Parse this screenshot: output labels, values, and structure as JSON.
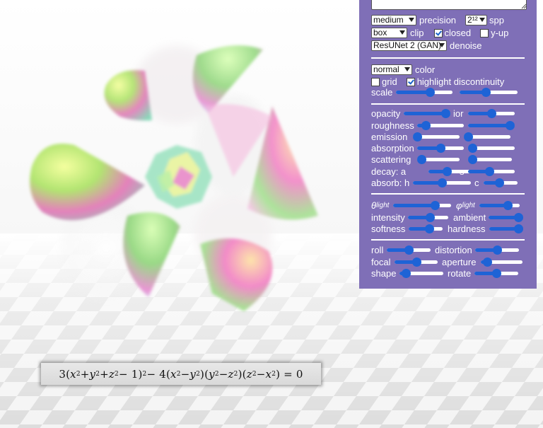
{
  "scene": {
    "formula_tokens": [
      "3(",
      "x",
      "2",
      " + ",
      "y",
      "2",
      " + ",
      "z",
      "2",
      " − 1)",
      "2",
      " − 4(",
      "x",
      "2",
      " − ",
      "y",
      "2",
      ")(",
      "y",
      "2",
      " − ",
      "z",
      "2",
      ")(",
      "z",
      "2",
      " − ",
      "x",
      "2",
      ") = 0"
    ],
    "formula": "3(x² + y² + z² − 1)² − 4(x² − y²)(y² − z²)(z² − x²) = 0"
  },
  "panel": {
    "background": "#7f6fb7",
    "accent": "#1e63d6",
    "render": {
      "precision_value": "medium",
      "precision_label": "precision",
      "spp_value": "2¹²",
      "spp_label": "spp",
      "clip_value": "box",
      "clip_label": "clip",
      "closed_label": "closed",
      "closed_checked": true,
      "yup_label": "y-up",
      "yup_checked": false,
      "denoise_value": "ResUNet 2 (GAN)",
      "denoise_label": "denoise"
    },
    "color": {
      "color_value": "normal",
      "color_label": "color",
      "grid_label": "grid",
      "grid_checked": false,
      "highlight_label": "highlight discontinuity",
      "highlight_checked": true,
      "scale_label": "scale",
      "scale_a": 0.6,
      "scale_b": 0.45
    },
    "material": {
      "opacity_label": "opacity",
      "opacity": 0.9,
      "ior_label": "ior",
      "ior": 0.5,
      "roughness_label": "roughness",
      "roughness": 0.18,
      "roughness_b": 0.9,
      "emission_label": "emission",
      "emission": 0.0,
      "emission_b": 0.0,
      "absorption_label": "absorption",
      "absorption": 0.5,
      "absorption_b": 0.08,
      "scattering_label": "scattering",
      "scattering": 0.0,
      "scattering_b": 0.0,
      "decay_label": "decay: a",
      "decay_a": 0.4,
      "s_label": "s",
      "s": 0.45,
      "absorb_label": "absorb: h",
      "absorb_h": 0.5,
      "c_label": "c",
      "c": 0.45
    },
    "light": {
      "theta_label": "θ",
      "theta_sub": "light",
      "theta": 0.72,
      "phi_label": "φ",
      "phi_sub": "light",
      "phi": 0.7,
      "intensity_label": "intensity",
      "intensity": 0.55,
      "ambient_label": "ambient",
      "ambient": 0.88,
      "softness_label": "softness",
      "softness": 0.6,
      "hardness_label": "hardness",
      "hardness": 0.98
    },
    "camera": {
      "roll_label": "roll",
      "roll": 0.5,
      "distortion_label": "distortion",
      "distortion": 0.5,
      "focal_label": "focal",
      "focal": 0.5,
      "aperture_label": "aperture",
      "aperture": 0.15,
      "shape_label": "shape",
      "shape": 0.15,
      "rotate_label": "rotate",
      "rotate": 0.5
    }
  }
}
